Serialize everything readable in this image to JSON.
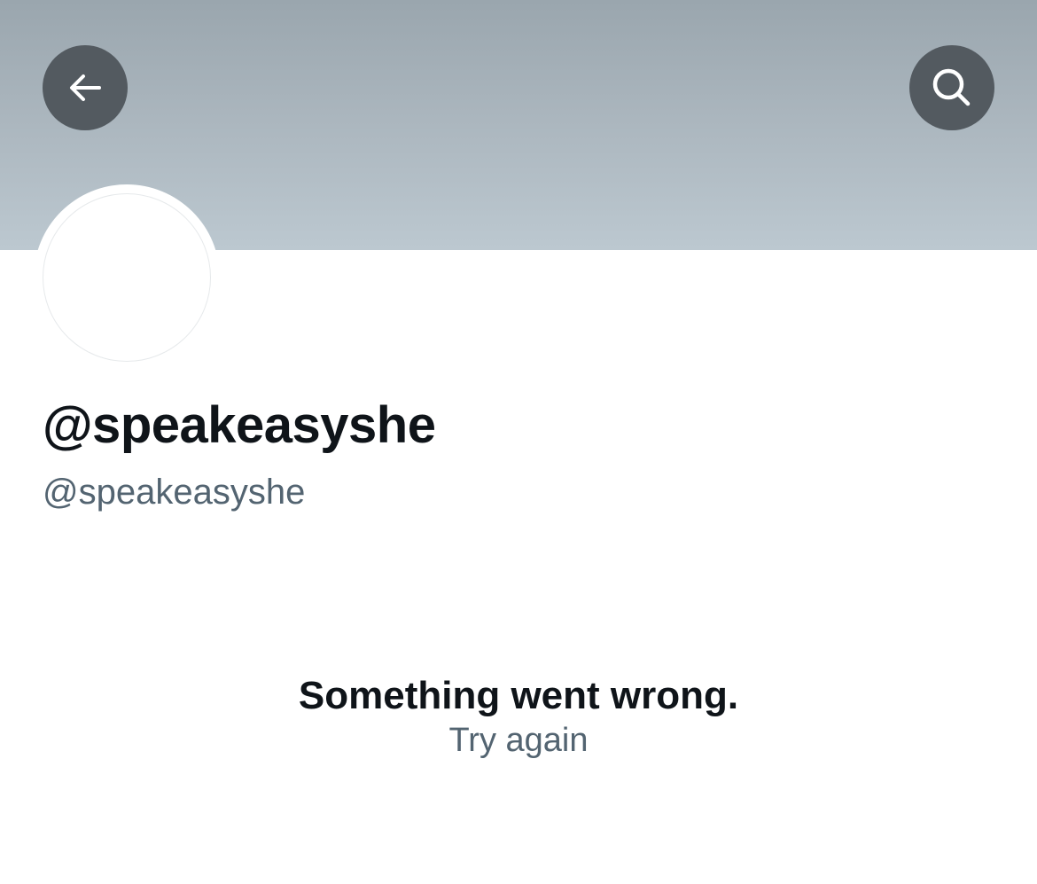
{
  "header": {
    "back_icon": "arrow-left-icon",
    "search_icon": "search-icon"
  },
  "profile": {
    "display_name": "@speakeasyshe",
    "handle": "@speakeasyshe"
  },
  "error": {
    "title": "Something went wrong.",
    "retry_label": "Try again"
  },
  "colors": {
    "primary_text": "#0f1419",
    "secondary_text": "#536471",
    "banner_top": "#9aa6ae",
    "banner_bottom": "#bcc8d0",
    "button_bg": "#535a60"
  }
}
